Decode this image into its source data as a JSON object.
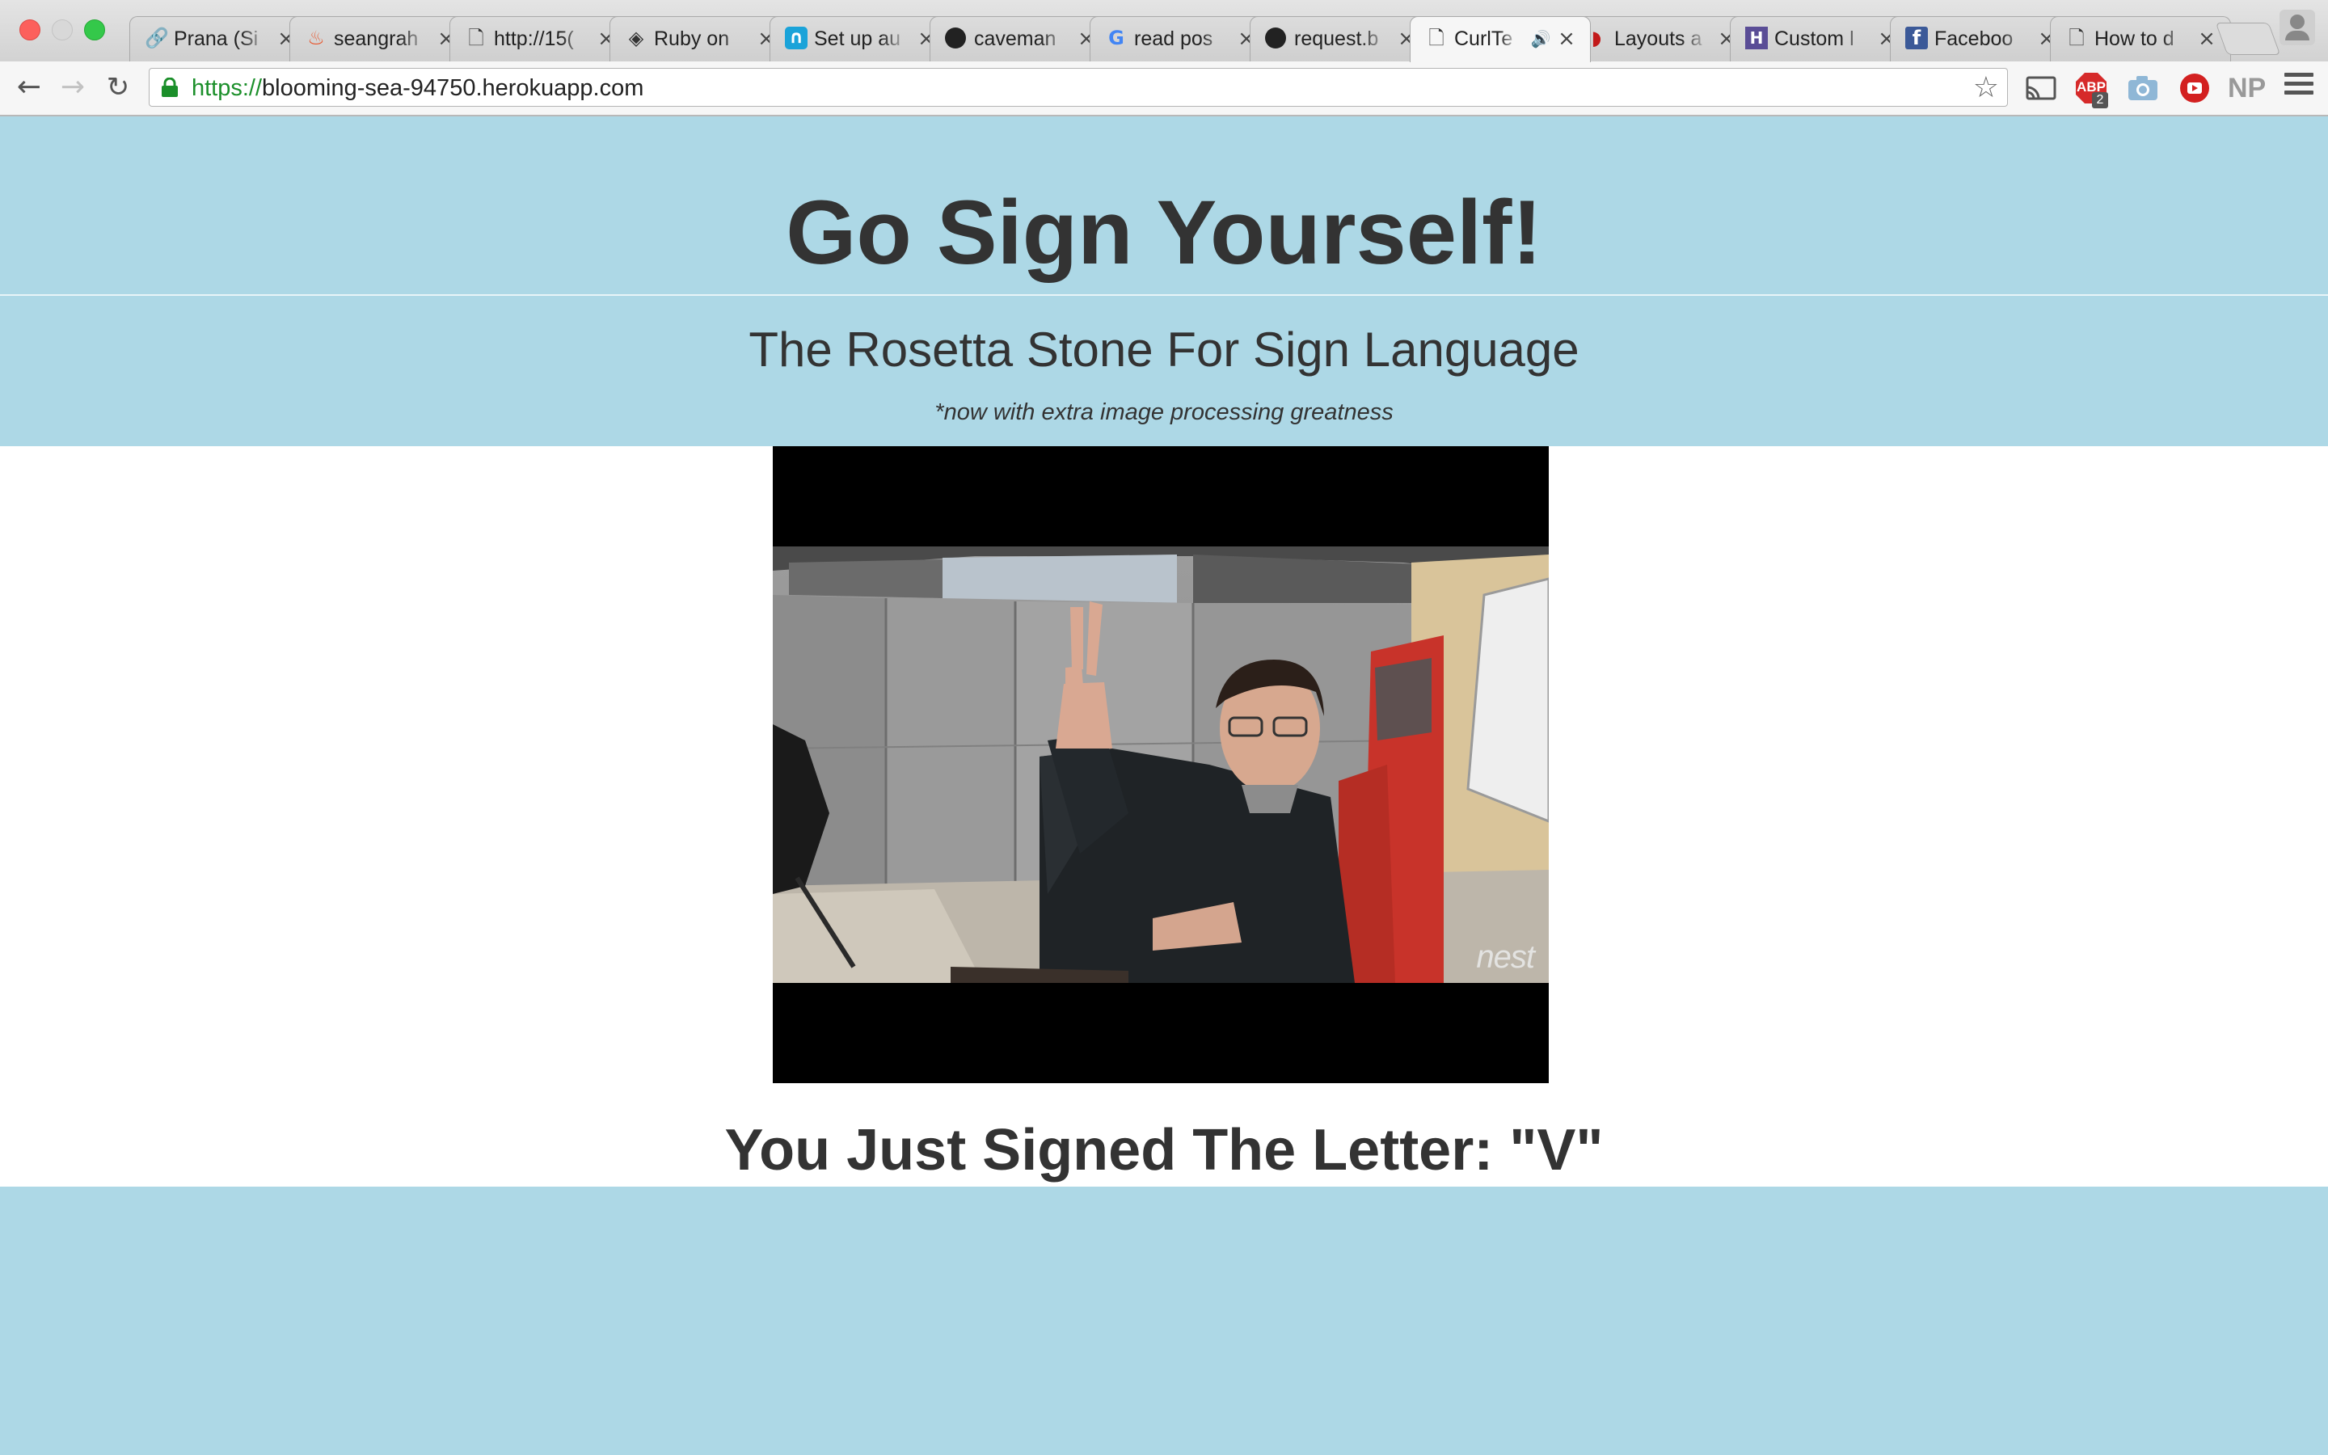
{
  "browser": {
    "tabs": [
      {
        "title": "Prana (Si",
        "icon": "link-icon",
        "active": false
      },
      {
        "title": "seangrah",
        "icon": "flame-icon",
        "active": false
      },
      {
        "title": "http://15(",
        "icon": "page-icon",
        "active": false
      },
      {
        "title": "Ruby on",
        "icon": "gem-icon",
        "active": false
      },
      {
        "title": "Set up au",
        "icon": "n-logo-icon",
        "active": false
      },
      {
        "title": "caveman",
        "icon": "github-icon",
        "active": false
      },
      {
        "title": "read pos",
        "icon": "google-icon",
        "active": false
      },
      {
        "title": "request.b",
        "icon": "github-icon",
        "active": false
      },
      {
        "title": "CurlTe",
        "icon": "page-icon",
        "active": true,
        "audio": true
      },
      {
        "title": "Layouts a",
        "icon": "rails-icon",
        "active": false
      },
      {
        "title": "Custom l",
        "icon": "h-logo-icon",
        "active": false
      },
      {
        "title": "Faceboo",
        "icon": "facebook-icon",
        "active": false
      },
      {
        "title": "How to d",
        "icon": "page-icon",
        "active": false
      }
    ],
    "url": {
      "scheme": "https://",
      "host": "blooming-sea-94750.herokuapp.com"
    },
    "extensions": {
      "abp_label": "ABP",
      "abp_badge": "2",
      "np_label": "NP"
    }
  },
  "page": {
    "title": "Go Sign Yourself!",
    "subtitle": "The Rosetta Stone For Sign Language",
    "tagline": "*now with extra image processing greatness",
    "video": {
      "watermark": "nest"
    },
    "result": "You Just Signed The Letter: \"V\""
  },
  "colors": {
    "page_background": "#add8e6",
    "text": "#333333",
    "video_background": "#000000"
  }
}
